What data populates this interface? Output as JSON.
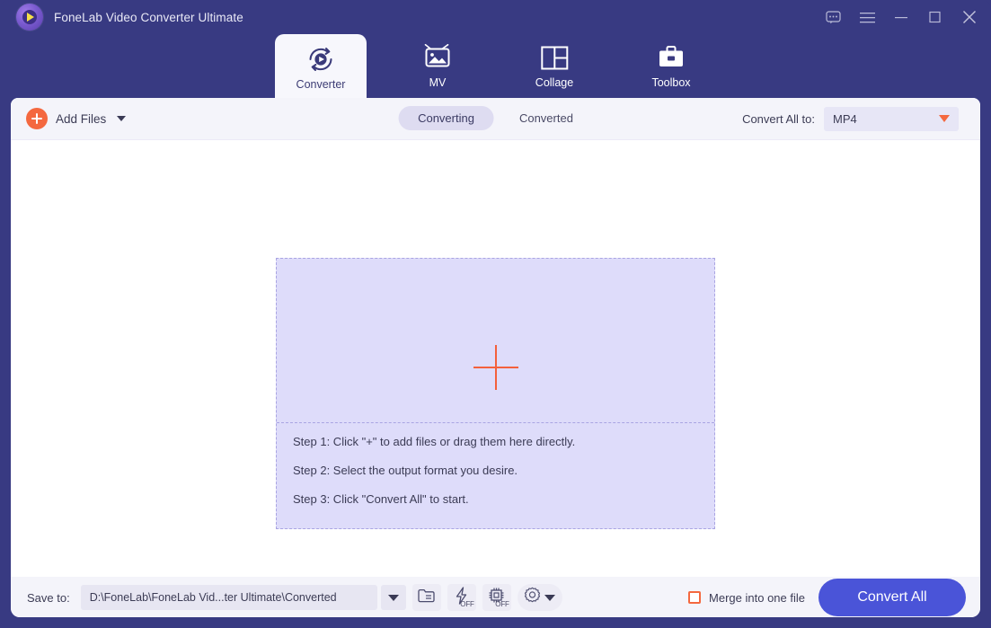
{
  "app": {
    "title": "FoneLab Video Converter Ultimate",
    "logo_icon": "fonelab-logo-icon"
  },
  "window_controls": [
    {
      "name": "feedback-icon",
      "glyph": "chat-bubble"
    },
    {
      "name": "menu-icon",
      "glyph": "hamburger"
    },
    {
      "name": "minimize-icon",
      "glyph": "minus"
    },
    {
      "name": "maximize-icon",
      "glyph": "square"
    },
    {
      "name": "close-icon",
      "glyph": "cross"
    }
  ],
  "nav": {
    "tabs": [
      {
        "label": "Converter",
        "icon": "converter-icon",
        "active": true
      },
      {
        "label": "MV",
        "icon": "mv-icon",
        "active": false
      },
      {
        "label": "Collage",
        "icon": "collage-icon",
        "active": false
      },
      {
        "label": "Toolbox",
        "icon": "toolbox-icon",
        "active": false
      }
    ]
  },
  "toolbar": {
    "add_files_label": "Add Files",
    "add_files_icon": "plus-circle-icon",
    "segments": [
      {
        "label": "Converting",
        "active": true
      },
      {
        "label": "Converted",
        "active": false
      }
    ],
    "convert_all_to_label": "Convert All to:",
    "format_value": "MP4"
  },
  "dropzone": {
    "plus_icon": "large-plus-icon",
    "steps": [
      "Step 1: Click \"+\" to add files or drag them here directly.",
      "Step 2: Select the output format you desire.",
      "Step 3: Click \"Convert All\" to start."
    ]
  },
  "bottombar": {
    "save_to_label": "Save to:",
    "save_to_path": "D:\\FoneLab\\FoneLab Vid...ter Ultimate\\Converted",
    "buttons": [
      {
        "name": "open-folder-icon",
        "state": ""
      },
      {
        "name": "hardware-acceleration-icon",
        "state": "OFF"
      },
      {
        "name": "gpu-acceleration-icon",
        "state": "OFF"
      },
      {
        "name": "settings-gear-icon",
        "state": ""
      }
    ],
    "merge_label": "Merge into one file",
    "merge_checked": false,
    "convert_all_label": "Convert All"
  },
  "colors": {
    "header_navy": "#383a82",
    "accent_blue": "#4a54d8",
    "accent_orange": "#f4683f",
    "dropzone_fill": "#dedcfa",
    "dropzone_border": "#a9a4e2",
    "toolbar_bg": "#f4f4fa"
  }
}
